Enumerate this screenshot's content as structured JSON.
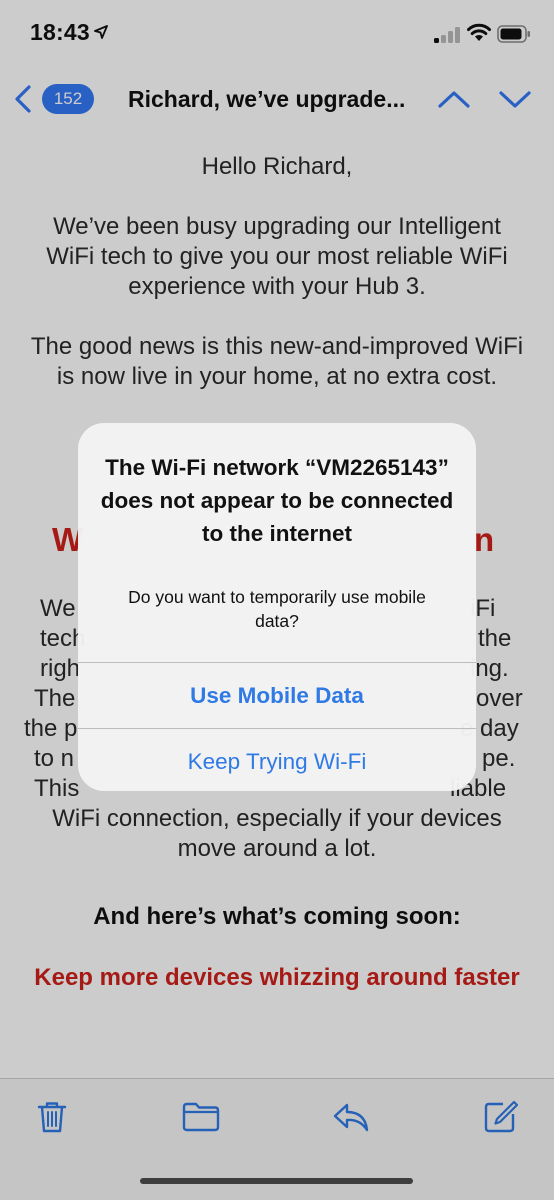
{
  "status_bar": {
    "time": "18:43",
    "icons": [
      "location-arrow-icon",
      "cellular-signal-icon",
      "wifi-icon",
      "battery-icon"
    ]
  },
  "nav": {
    "unread_count": "152",
    "title": "Richard, we’ve upgrade...",
    "icons": [
      "back-chevron-icon",
      "chevron-up-icon",
      "chevron-down-icon"
    ]
  },
  "email": {
    "greeting": "Hello Richard,",
    "para1": "We’ve been busy upgrading our Intelligent WiFi tech to give you our most reliable WiFi experience with your Hub 3.",
    "para2": "The good news is this new-and-improved WiFi is now live in your home, at no extra cost.",
    "heading1_start": "W",
    "heading1_end": "n",
    "para3_lines": [
      [
        "We",
        "iFi"
      ],
      [
        "tech",
        "the"
      ],
      [
        "righ",
        "ing."
      ],
      [
        "The",
        "over"
      ],
      [
        "the p",
        "e day"
      ],
      [
        "to n",
        "pe."
      ],
      [
        "This",
        "liable"
      ]
    ],
    "para4": "WiFi connection, especially if your devices move around a lot.",
    "coming_soon": "And here’s what’s coming soon:",
    "heading2": "Keep more devices whizzing around faster"
  },
  "alert": {
    "title": "The Wi-Fi network “VM2265143” does not appear to be connected to the internet",
    "message": "Do you want to temporarily use mobile data?",
    "primary_button": "Use Mobile Data",
    "secondary_button": "Keep Trying Wi-Fi"
  },
  "toolbar": {
    "icons": [
      "trash-icon",
      "folder-icon",
      "reply-icon",
      "compose-icon"
    ]
  },
  "colors": {
    "accent_blue": "#3478f6",
    "alert_button_blue": "#2f7ae5",
    "heading_red": "#d0211b",
    "toolbar_icon_blue": "#2f7ae5"
  }
}
